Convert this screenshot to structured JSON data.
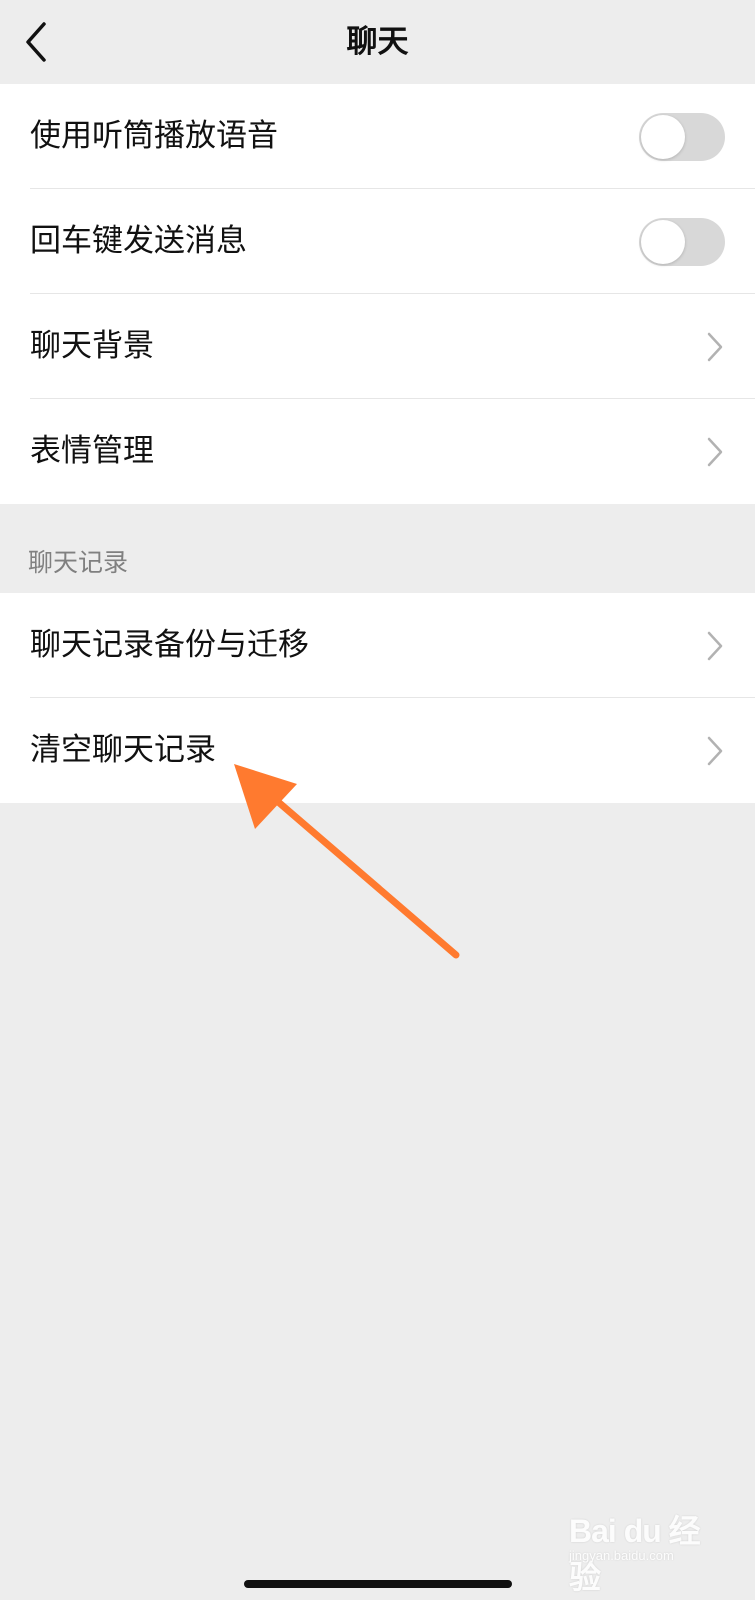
{
  "nav": {
    "title": "聊天",
    "back_icon": "chevron-left-icon"
  },
  "settings_group": {
    "items": [
      {
        "label": "使用听筒播放语音",
        "control": "toggle",
        "enabled": false
      },
      {
        "label": "回车键发送消息",
        "control": "toggle",
        "enabled": false
      },
      {
        "label": "聊天背景",
        "control": "chevron-right-icon"
      },
      {
        "label": "表情管理",
        "control": "chevron-right-icon"
      }
    ]
  },
  "chat_history_section": {
    "header": "聊天记录",
    "items": [
      {
        "label": "聊天记录备份与迁移",
        "control": "chevron-right-icon"
      },
      {
        "label": "清空聊天记录",
        "control": "chevron-right-icon"
      }
    ]
  },
  "annotation": {
    "arrow_color": "#ff7a2f",
    "points_to": "清空聊天记录"
  },
  "watermark": {
    "main": "Bai du 经验",
    "sub": "jingyan.baidu.com"
  },
  "colors": {
    "background": "#ededed",
    "row_background": "#ffffff",
    "toggle_off": "#d8d8d8",
    "secondary_text": "#808080",
    "chevron": "#b2b2b2"
  }
}
